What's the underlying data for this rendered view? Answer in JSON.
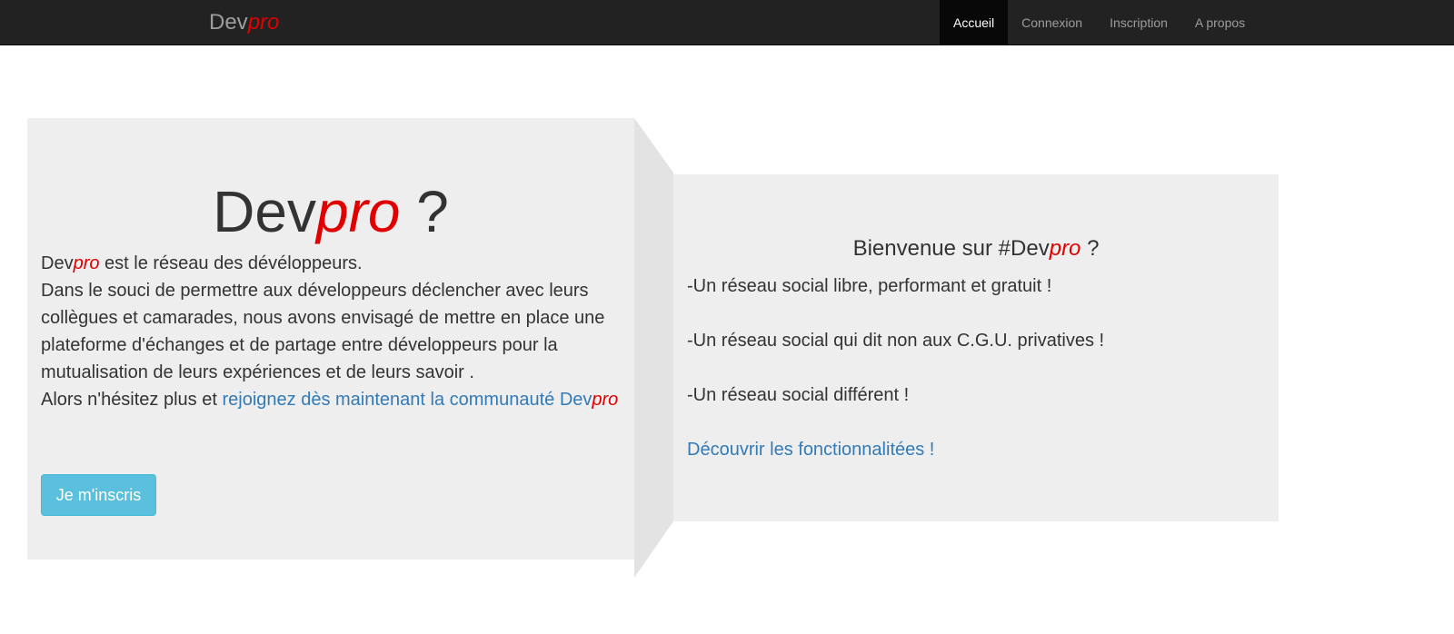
{
  "navbar": {
    "brand_main": "Dev",
    "brand_accent": "pro",
    "items": [
      {
        "label": "Accueil",
        "active": true
      },
      {
        "label": "Connexion"
      },
      {
        "label": "Inscription"
      },
      {
        "label": "A propos"
      }
    ]
  },
  "hero": {
    "title_main": "Dev",
    "title_accent": "pro",
    "title_suffix": " ?",
    "brand_main": "Dev",
    "brand_accent": "pro",
    "line1_rest": " est le réseau des dévéloppeurs.",
    "paragraph": "Dans le souci de permettre aux développeurs déclencher avec leurs collègues et camarades, nous avons envisagé de mettre en place une plateforme d'échanges et de partage entre développeurs pour la mutualisation de leurs expériences et de leurs savoir .",
    "cta_prefix": "Alors n'hésitez plus et ",
    "cta_link": "rejoignez dès maintenant la communauté Dev",
    "cta_link_accent": "pro",
    "button_label": "Je m'inscris"
  },
  "welcome": {
    "title_prefix": "Bienvenue sur #Dev",
    "title_accent": "pro",
    "title_suffix": " ?",
    "features": [
      "-Un réseau social libre, performant et gratuit !",
      "-Un réseau social qui dit non aux C.G.U. privatives !",
      "-Un réseau social différent !"
    ],
    "discover_link": "Découvrir les fonctionnalitées !"
  },
  "colors": {
    "navbar_bg": "#222222",
    "accent_red": "#e00000",
    "link_blue": "#337ab7",
    "button_info": "#5bc0de",
    "panel_bg": "#eeeeee"
  }
}
